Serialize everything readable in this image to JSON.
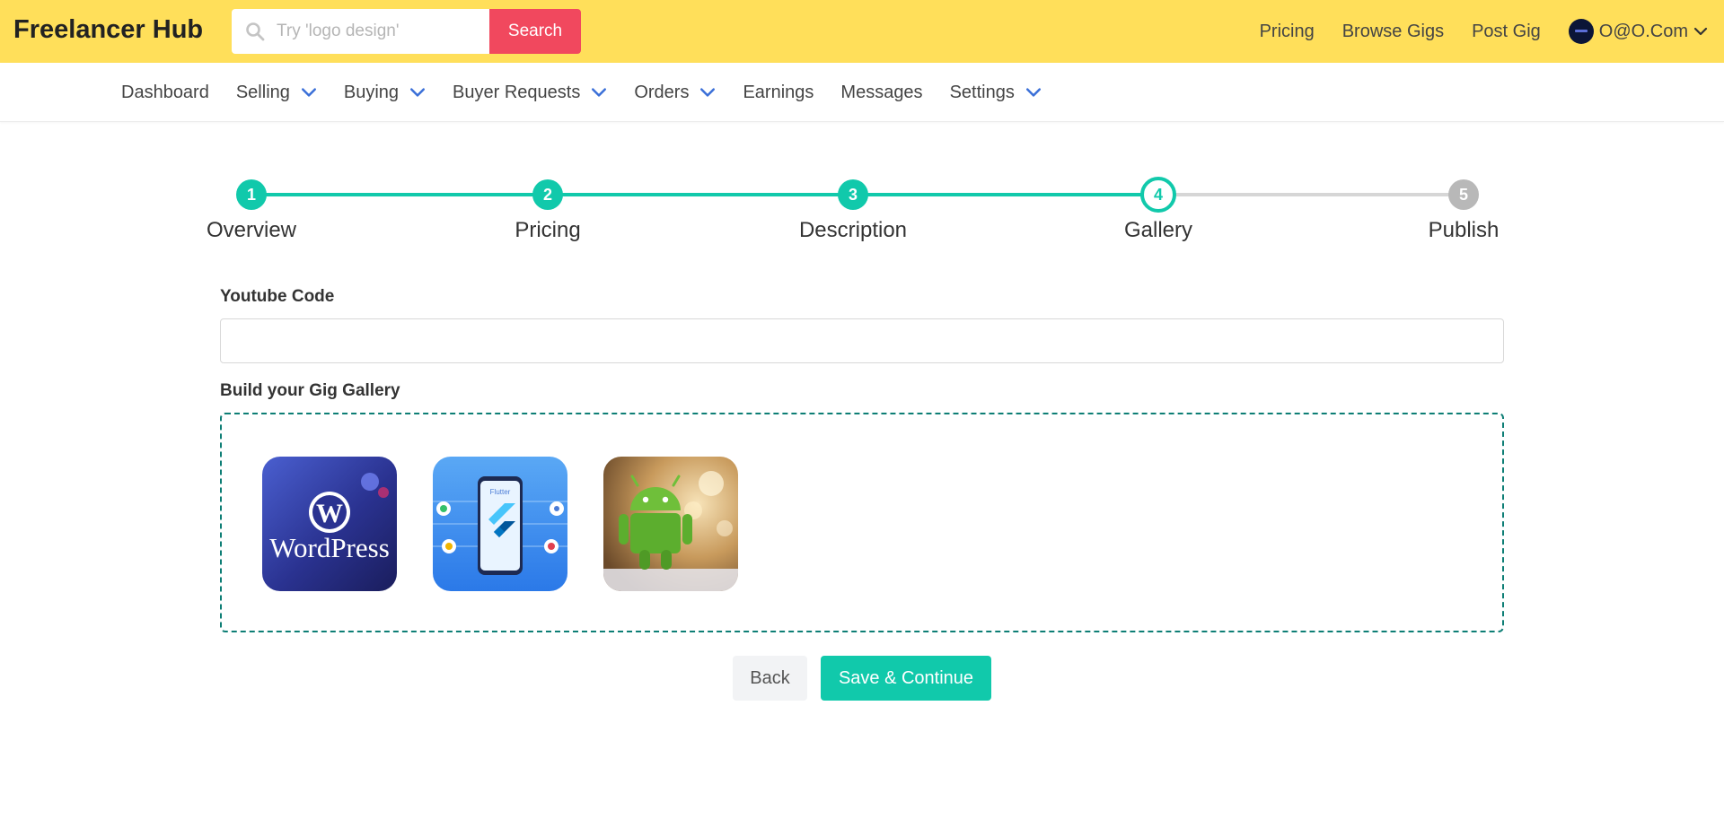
{
  "header": {
    "brand": "Freelancer Hub",
    "search": {
      "placeholder": "Try 'logo design'",
      "value": "",
      "button_label": "Search"
    },
    "links": [
      "Pricing",
      "Browse Gigs",
      "Post Gig"
    ],
    "user_label": "O@O.Com",
    "background_color": "#ffdf5a",
    "search_button_color": "#f1485e"
  },
  "subnav": {
    "items": [
      {
        "label": "Dashboard",
        "has_dropdown": false
      },
      {
        "label": "Selling",
        "has_dropdown": true
      },
      {
        "label": "Buying",
        "has_dropdown": true
      },
      {
        "label": "Buyer Requests",
        "has_dropdown": true
      },
      {
        "label": "Orders",
        "has_dropdown": true
      },
      {
        "label": "Earnings",
        "has_dropdown": false
      },
      {
        "label": "Messages",
        "has_dropdown": false
      },
      {
        "label": "Settings",
        "has_dropdown": true
      }
    ]
  },
  "stepper": {
    "accent_color": "#11c9ab",
    "current_step": 4,
    "steps": [
      {
        "number": "1",
        "label": "Overview",
        "state": "done"
      },
      {
        "number": "2",
        "label": "Pricing",
        "state": "done"
      },
      {
        "number": "3",
        "label": "Description",
        "state": "done"
      },
      {
        "number": "4",
        "label": "Gallery",
        "state": "active"
      },
      {
        "number": "5",
        "label": "Publish",
        "state": "todo"
      }
    ]
  },
  "form": {
    "youtube_label": "Youtube Code",
    "youtube_value": "",
    "gallery_label": "Build your Gig Gallery",
    "gallery_images": [
      {
        "name": "wordpress-image",
        "caption": "WordPress"
      },
      {
        "name": "flutter-image",
        "caption": "Flutter"
      },
      {
        "name": "android-image",
        "caption": ""
      }
    ]
  },
  "actions": {
    "back_label": "Back",
    "save_label": "Save & Continue"
  }
}
